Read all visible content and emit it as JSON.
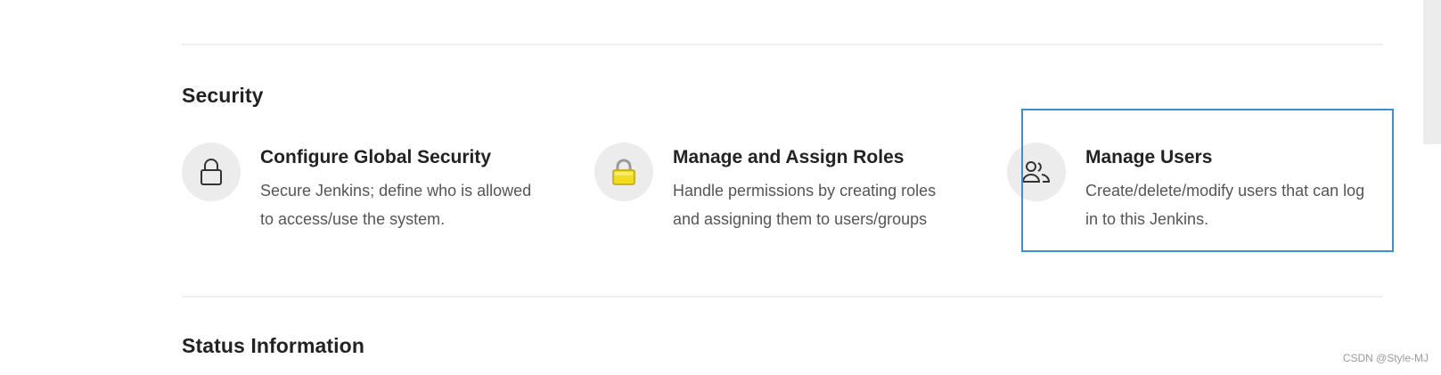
{
  "sections": {
    "security_title": "Security",
    "status_title": "Status Information"
  },
  "tiles": [
    {
      "title": "Configure Global Security",
      "description": "Secure Jenkins; define who is allowed to access/use the system.",
      "icon": "padlock-outline-icon"
    },
    {
      "title": "Manage and Assign Roles",
      "description": "Handle permissions by creating roles and assigning them to users/groups",
      "icon": "yellow-padlock-icon"
    },
    {
      "title": "Manage Users",
      "description": "Create/delete/modify users that can log in to this Jenkins.",
      "icon": "users-icon"
    }
  ],
  "colors": {
    "highlight": "#3b8fd9",
    "icon_circle": "#ececec",
    "padlock_yellow": "#f2dc1c"
  },
  "watermark": "CSDN @Style-MJ"
}
